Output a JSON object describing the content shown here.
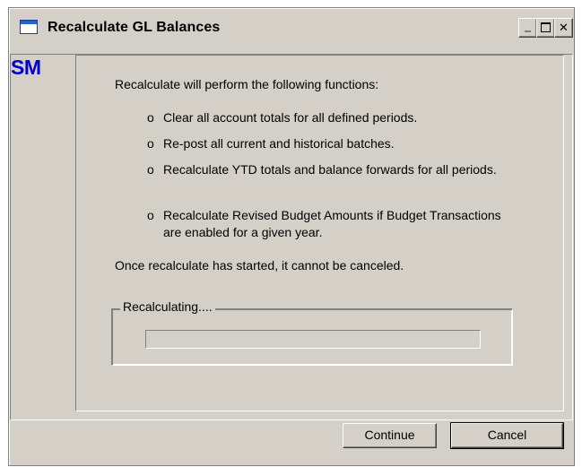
{
  "window": {
    "title": "Recalculate GL Balances"
  },
  "logo": {
    "text": "SM",
    "color": "#0000cc"
  },
  "content": {
    "intro": "Recalculate will perform the following functions:",
    "bullet_glyph": "o",
    "functions": [
      "Clear all account totals for all defined periods.",
      "Re-post all current and historical batches.",
      "Recalculate YTD totals and balance forwards for all periods.",
      "Recalculate Revised Budget Amounts if Budget Transactions are enabled for a given year."
    ],
    "warning": "Once recalculate has started, it cannot be canceled."
  },
  "progress": {
    "label": "Recalculating....",
    "value_percent": 0
  },
  "buttons": {
    "continue_label": "Continue",
    "cancel_label": "Cancel"
  },
  "colors": {
    "window_bg": "#d4d0c8",
    "title_icon_accent": "#2b5fc9"
  }
}
